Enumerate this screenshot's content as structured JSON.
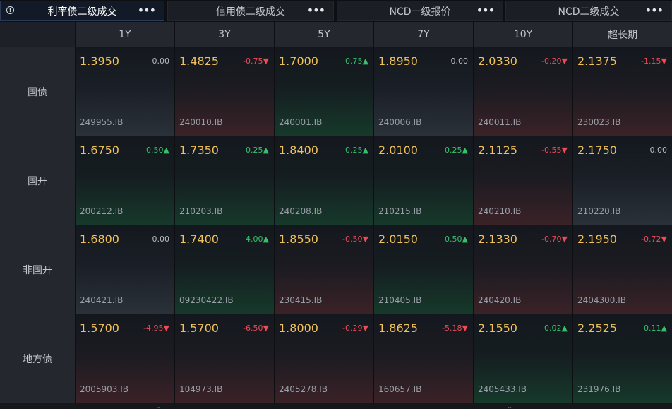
{
  "tabs": [
    {
      "label": "利率债二级成交",
      "active": true,
      "more": "•••"
    },
    {
      "label": "信用债二级成交",
      "active": false,
      "more": "•••"
    },
    {
      "label": "NCD一级报价",
      "active": false,
      "more": "•••"
    },
    {
      "label": "NCD二级成交",
      "active": false,
      "more": "•••"
    }
  ],
  "info_icon_text": "!",
  "columns": [
    "1Y",
    "3Y",
    "5Y",
    "7Y",
    "10Y",
    "超长期"
  ],
  "rows": [
    {
      "label": "国债",
      "cells": [
        {
          "yield": "1.3950",
          "change": "0.00",
          "dir": "flat",
          "code": "249955.IB"
        },
        {
          "yield": "1.4825",
          "change": "-0.75▼",
          "dir": "down",
          "code": "240010.IB"
        },
        {
          "yield": "1.7000",
          "change": "0.75▲",
          "dir": "up",
          "code": "240001.IB"
        },
        {
          "yield": "1.8950",
          "change": "0.00",
          "dir": "flat",
          "code": "240006.IB"
        },
        {
          "yield": "2.0330",
          "change": "-0.20▼",
          "dir": "down",
          "code": "240011.IB"
        },
        {
          "yield": "2.1375",
          "change": "-1.15▼",
          "dir": "down",
          "code": "230023.IB"
        }
      ]
    },
    {
      "label": "国开",
      "cells": [
        {
          "yield": "1.6750",
          "change": "0.50▲",
          "dir": "up",
          "code": "200212.IB"
        },
        {
          "yield": "1.7350",
          "change": "0.25▲",
          "dir": "up",
          "code": "210203.IB"
        },
        {
          "yield": "1.8400",
          "change": "0.25▲",
          "dir": "up",
          "code": "240208.IB"
        },
        {
          "yield": "2.0100",
          "change": "0.25▲",
          "dir": "up",
          "code": "210215.IB"
        },
        {
          "yield": "2.1125",
          "change": "-0.55▼",
          "dir": "down",
          "code": "240210.IB"
        },
        {
          "yield": "2.1750",
          "change": "0.00",
          "dir": "flat",
          "code": "210220.IB"
        }
      ]
    },
    {
      "label": "非国开",
      "cells": [
        {
          "yield": "1.6800",
          "change": "0.00",
          "dir": "flat",
          "code": "240421.IB"
        },
        {
          "yield": "1.7400",
          "change": "4.00▲",
          "dir": "up",
          "code": "09230422.IB"
        },
        {
          "yield": "1.8550",
          "change": "-0.50▼",
          "dir": "down",
          "code": "230415.IB"
        },
        {
          "yield": "2.0150",
          "change": "0.50▲",
          "dir": "up",
          "code": "210405.IB"
        },
        {
          "yield": "2.1330",
          "change": "-0.70▼",
          "dir": "down",
          "code": "240420.IB"
        },
        {
          "yield": "2.1950",
          "change": "-0.72▼",
          "dir": "down",
          "code": "2404300.IB"
        }
      ]
    },
    {
      "label": "地方债",
      "cells": [
        {
          "yield": "1.5700",
          "change": "-4.95▼",
          "dir": "down",
          "code": "2005903.IB"
        },
        {
          "yield": "1.5700",
          "change": "-6.50▼",
          "dir": "down",
          "code": "104973.IB"
        },
        {
          "yield": "1.8000",
          "change": "-0.29▼",
          "dir": "down",
          "code": "2405278.IB"
        },
        {
          "yield": "1.8625",
          "change": "-5.18▼",
          "dir": "down",
          "code": "160657.IB"
        },
        {
          "yield": "2.1550",
          "change": "0.02▲",
          "dir": "up",
          "code": "2405433.IB"
        },
        {
          "yield": "2.2525",
          "change": "0.11▲",
          "dir": "up",
          "code": "231976.IB"
        }
      ]
    }
  ],
  "colors": {
    "yield": "#f1c15a",
    "up": "#35c26a",
    "down": "#ee4b54",
    "active_tab": "#131a27"
  }
}
